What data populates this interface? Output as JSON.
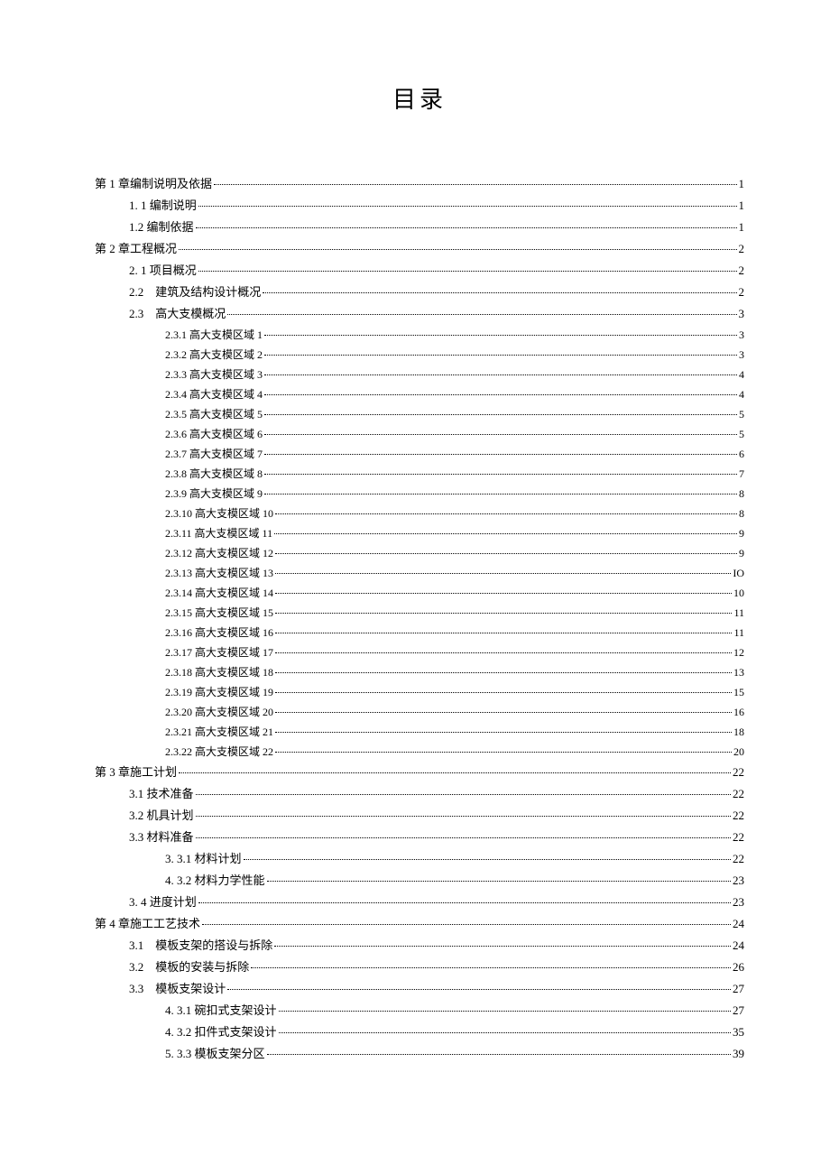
{
  "title": "目录",
  "entries": [
    {
      "indent": 0,
      "dot": 1,
      "label": "第 1 章编制说明及依据",
      "page": "1"
    },
    {
      "indent": 1,
      "dot": 1,
      "label": "1. 1 编制说明",
      "page": "1"
    },
    {
      "indent": 1,
      "dot": 1,
      "label": "1.2 编制依据",
      "page": "1"
    },
    {
      "indent": 0,
      "dot": 1,
      "label": "第 2 章工程概况",
      "page": "2"
    },
    {
      "indent": 1,
      "dot": 1,
      "label": "2. 1 项目概况",
      "page": "2"
    },
    {
      "indent": 1,
      "dot": 1,
      "label": "2.2 建筑及结构设计概况",
      "page": "2"
    },
    {
      "indent": 1,
      "dot": 1,
      "label": "2.3 高大支模概况",
      "page": "3"
    },
    {
      "indent": 2,
      "dot": 2,
      "label": "2.3.1 高大支模区域 1",
      "page": "3"
    },
    {
      "indent": 2,
      "dot": 2,
      "label": "2.3.2 高大支模区域 2",
      "page": "3"
    },
    {
      "indent": 2,
      "dot": 2,
      "label": "2.3.3 高大支模区域 3",
      "page": "4"
    },
    {
      "indent": 2,
      "dot": 2,
      "label": "2.3.4 高大支模区域 4",
      "page": "4"
    },
    {
      "indent": 2,
      "dot": 2,
      "label": "2.3.5 高大支模区域 5",
      "page": "5"
    },
    {
      "indent": 2,
      "dot": 2,
      "label": "2.3.6 高大支模区域 6",
      "page": "5"
    },
    {
      "indent": 2,
      "dot": 2,
      "label": "2.3.7 高大支模区域 7",
      "page": "6"
    },
    {
      "indent": 2,
      "dot": 2,
      "label": "2.3.8 高大支模区域 8",
      "page": "7"
    },
    {
      "indent": 2,
      "dot": 2,
      "label": "2.3.9 高大支模区域 9",
      "page": "8"
    },
    {
      "indent": 2,
      "dot": 2,
      "label": "2.3.10 高大支模区域 10",
      "page": "8"
    },
    {
      "indent": 2,
      "dot": 2,
      "label": "2.3.11 高大支模区域 11",
      "page": "9"
    },
    {
      "indent": 2,
      "dot": 2,
      "label": "2.3.12 高大支模区域 12",
      "page": "9"
    },
    {
      "indent": 2,
      "dot": 2,
      "label": "2.3.13 高大支模区域 13",
      "page": "IO"
    },
    {
      "indent": 2,
      "dot": 2,
      "label": "2.3.14 高大支模区域 14",
      "page": "10"
    },
    {
      "indent": 2,
      "dot": 2,
      "label": "2.3.15 高大支模区域 15",
      "page": "11"
    },
    {
      "indent": 2,
      "dot": 2,
      "label": "2.3.16 高大支模区域 16",
      "page": "11"
    },
    {
      "indent": 2,
      "dot": 2,
      "label": "2.3.17 高大支模区域 17",
      "page": "12"
    },
    {
      "indent": 2,
      "dot": 2,
      "label": "2.3.18 高大支模区域 18",
      "page": "13"
    },
    {
      "indent": 2,
      "dot": 2,
      "label": "2.3.19 高大支模区域 19",
      "page": "15"
    },
    {
      "indent": 2,
      "dot": 2,
      "label": "2.3.20 高大支模区域 20",
      "page": "16"
    },
    {
      "indent": 2,
      "dot": 2,
      "label": "2.3.21 高大支模区域 21",
      "page": "18"
    },
    {
      "indent": 2,
      "dot": 2,
      "label": "2.3.22 高大支模区域 22",
      "page": "20"
    },
    {
      "indent": 0,
      "dot": 1,
      "label": "第 3 章施工计划",
      "page": "22"
    },
    {
      "indent": 1,
      "dot": 1,
      "label": "3.1 技术准备",
      "page": "22"
    },
    {
      "indent": 1,
      "dot": 1,
      "label": "3.2 机具计划",
      "page": "22"
    },
    {
      "indent": 1,
      "dot": 1,
      "label": "3.3 材料准备",
      "page": "22"
    },
    {
      "indent": 2,
      "dot": 1,
      "label": "3. 3.1 材料计划",
      "page": "22"
    },
    {
      "indent": 2,
      "dot": 1,
      "label": "4. 3.2 材料力学性能",
      "page": "23"
    },
    {
      "indent": 1,
      "dot": 1,
      "label": "3. 4 进度计划",
      "page": "23"
    },
    {
      "indent": 0,
      "dot": 1,
      "label": "第 4 章施工工艺技术",
      "page": "24"
    },
    {
      "indent": 1,
      "dot": 1,
      "label": "3.1 模板支架的搭设与拆除",
      "page": "24"
    },
    {
      "indent": 1,
      "dot": 1,
      "label": "3.2 模板的安装与拆除",
      "page": "26"
    },
    {
      "indent": 1,
      "dot": 1,
      "label": "3.3 模板支架设计",
      "page": "27"
    },
    {
      "indent": 2,
      "dot": 1,
      "label": "4. 3.1 碗扣式支架设计",
      "page": "27"
    },
    {
      "indent": 2,
      "dot": 1,
      "label": "4. 3.2 扣件式支架设计",
      "page": "35"
    },
    {
      "indent": 2,
      "dot": 1,
      "label": "5. 3.3 模板支架分区",
      "page": "39"
    }
  ]
}
